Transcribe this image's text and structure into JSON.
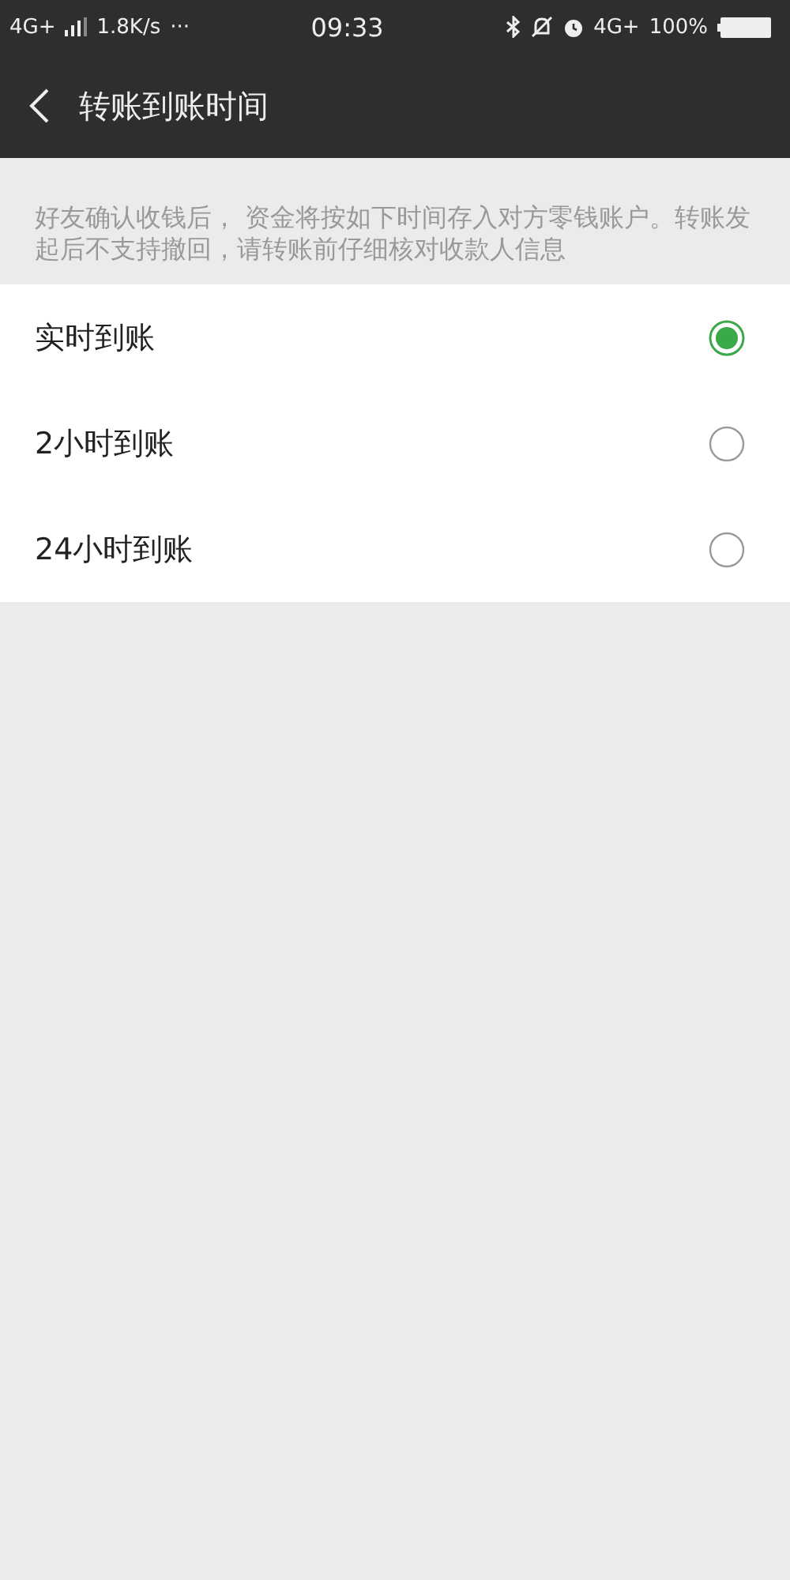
{
  "status_bar": {
    "network_left": "4G+",
    "speed": "1.8K/s",
    "more": "···",
    "time": "09:33",
    "network_right": "4G+",
    "battery": "100%"
  },
  "header": {
    "title": "转账到账时间"
  },
  "notice": "好友确认收钱后， 资金将按如下时间存入对方零钱账户。转账发起后不支持撤回，请转账前仔细核对收款人信息",
  "options": [
    {
      "label": "实时到账",
      "selected": true
    },
    {
      "label": "2小时到账",
      "selected": false
    },
    {
      "label": "24小时到账",
      "selected": false
    }
  ]
}
